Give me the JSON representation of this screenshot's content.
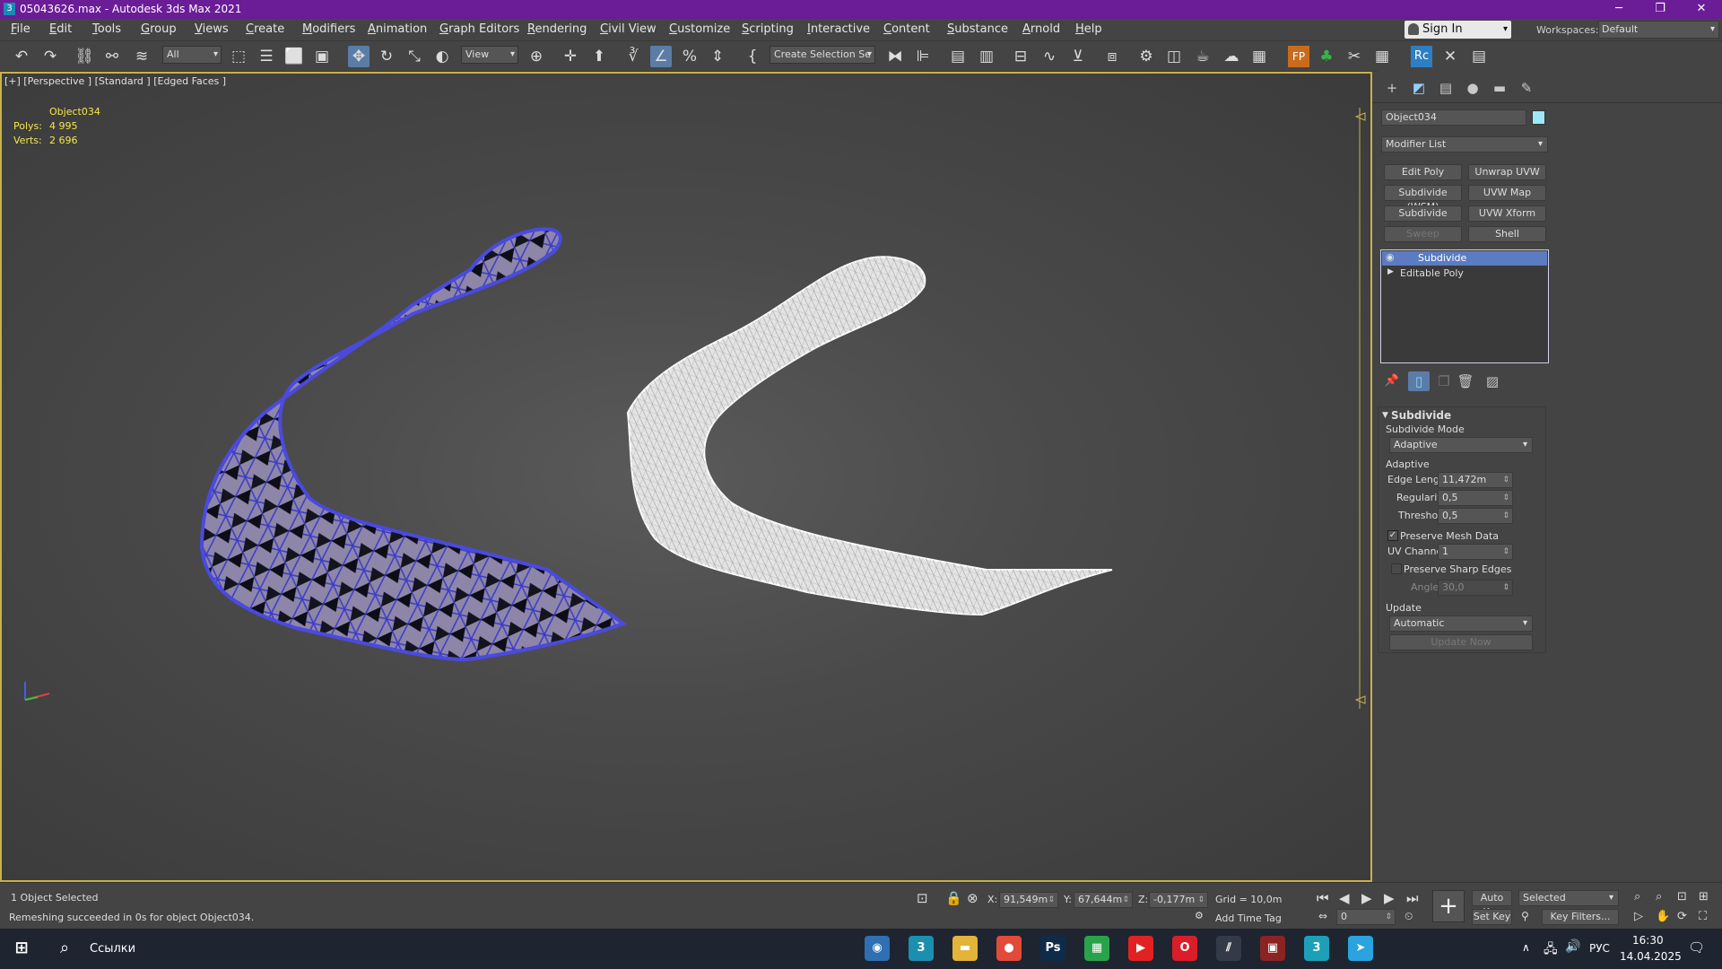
{
  "window": {
    "title": "05043626.max - Autodesk 3ds Max 2021",
    "app_icon": "3",
    "minimize_glyph": "─",
    "restore_glyph": "❐",
    "close_glyph": "✕"
  },
  "menu": {
    "items": [
      "File",
      "Edit",
      "Tools",
      "Group",
      "Views",
      "Create",
      "Modifiers",
      "Animation",
      "Graph Editors",
      "Rendering",
      "Civil View",
      "Customize",
      "Scripting",
      "Interactive",
      "Content",
      "Substance",
      "Arnold",
      "Help"
    ],
    "sign_in": "Sign In",
    "workspaces_label": "Workspaces:",
    "workspace_value": "Default"
  },
  "toolbar": {
    "filter_value": "All",
    "ref_coord_value": "View",
    "selection_set_placeholder": "Create Selection Se",
    "icons": [
      "undo-icon",
      "redo-icon",
      "link-icon",
      "unlink-icon",
      "bind-space-warp-icon",
      "select-object-icon",
      "select-by-name-icon",
      "rect-selection-icon",
      "window-crossing-icon",
      "select-move-icon",
      "select-rotate-icon",
      "select-scale-icon",
      "select-place-icon",
      "pivot-icon",
      "select-manipulate-icon",
      "keyboard-shortcut-icon",
      "snaps-toggle-icon",
      "angle-snap-icon",
      "percent-snap-icon",
      "spinner-snap-icon",
      "edit-named-selection-icon",
      "mirror-icon",
      "align-icon",
      "scene-explorer-icon",
      "layer-explorer-icon",
      "toggle-ribbon-icon",
      "curve-editor-icon",
      "schematic-view-icon",
      "material-editor-icon",
      "render-setup-icon",
      "rendered-frame-icon",
      "render-production-icon",
      "render-iterative-icon",
      "render-cloud-icon",
      "floorgenerator-icon",
      "forest-pack-icon",
      "railclone-icon",
      "tool-icon",
      "table-icon",
      "rc-icon",
      "wrench-icon",
      "spreadsheet-icon"
    ]
  },
  "viewport": {
    "label": "[+] [Perspective ] [Standard ] [Edged Faces ]",
    "object_name": "Object034",
    "polys_label": "Polys:",
    "polys_value": "4 995",
    "verts_label": "Verts:",
    "verts_value": "2 696"
  },
  "command_panel": {
    "tabs": [
      "create-tab-icon",
      "modify-tab-icon",
      "hierarchy-tab-icon",
      "motion-tab-icon",
      "display-tab-icon",
      "utilities-tab-icon"
    ],
    "object_name": "Object034",
    "object_color": "#9ee8f5",
    "modifier_list": "Modifier List",
    "modifier_buttons": [
      {
        "label": "Edit Poly",
        "enabled": true
      },
      {
        "label": "Unwrap UVW",
        "enabled": true
      },
      {
        "label": "Subdivide (WSM)",
        "enabled": true
      },
      {
        "label": "UVW Map",
        "enabled": true
      },
      {
        "label": "Subdivide",
        "enabled": true
      },
      {
        "label": "UVW Xform",
        "enabled": true
      },
      {
        "label": "Sweep",
        "enabled": false
      },
      {
        "label": "Shell",
        "enabled": true
      }
    ],
    "stack": [
      {
        "label": "Subdivide",
        "selected": true
      },
      {
        "label": "Editable Poly",
        "selected": false
      }
    ],
    "rollout": {
      "title": "Subdivide",
      "mode_label": "Subdivide Mode",
      "mode_value": "Adaptive",
      "adaptive_label": "Adaptive",
      "edge_length_label": "Edge Length:",
      "edge_length_value": "11,472m",
      "regularity_label": "Regularity:",
      "regularity_value": "0,5",
      "threshold_label": "Threshold:",
      "threshold_value": "0,5",
      "preserve_mesh_label": "Preserve Mesh Data",
      "preserve_mesh_checked": true,
      "uv_channel_label": "UV Channel:",
      "uv_channel_value": "1",
      "preserve_sharp_label": "Preserve Sharp Edges",
      "preserve_sharp_checked": false,
      "angle_label": "Angle:",
      "angle_value": "30,0",
      "update_label": "Update",
      "update_value": "Automatic",
      "update_now": "Update Now"
    }
  },
  "status": {
    "selected": "1 Object Selected",
    "message": "Remeshing succeeded in 0s for object Object034.",
    "x_label": "X:",
    "x_value": "91,549m",
    "y_label": "Y:",
    "y_value": "67,644m",
    "z_label": "Z:",
    "z_value": "-0,177m",
    "grid": "Grid = 10,0m",
    "add_time_tag": "Add Time Tag",
    "frame_value": "0",
    "auto_key": "Auto Key",
    "set_key": "Set Key",
    "key_mode": "Selected",
    "key_filters": "Key Filters..."
  },
  "taskbar": {
    "search_text": "Ссылки",
    "apps": [
      {
        "name": "app-cursor-icon",
        "label": "◉",
        "color": "#2f6fb3"
      },
      {
        "name": "app-3dsmax-icon",
        "label": "3",
        "color": "#1c8fb0"
      },
      {
        "name": "app-explorer-icon",
        "label": "▬",
        "color": "#e3b33a"
      },
      {
        "name": "app-chrome-icon",
        "label": "●",
        "color": "#e24a3a"
      },
      {
        "name": "app-photoshop-icon",
        "label": "Ps",
        "color": "#0f2b4a"
      },
      {
        "name": "app-chart-icon",
        "label": "▦",
        "color": "#29a34a"
      },
      {
        "name": "app-youtube-icon",
        "label": "▶",
        "color": "#e22222"
      },
      {
        "name": "app-opera-icon",
        "label": "O",
        "color": "#d91e2a"
      },
      {
        "name": "app-stripe-icon",
        "label": "⫽",
        "color": "#333a48"
      },
      {
        "name": "app-game-icon",
        "label": "▣",
        "color": "#8c2323"
      },
      {
        "name": "app-3dsmax-active-icon",
        "label": "3",
        "color": "#1ba0b8"
      },
      {
        "name": "app-telegram-icon",
        "label": "➤",
        "color": "#2aa3df"
      }
    ],
    "lang": "РУС",
    "time": "16:30",
    "date": "14.04.2025"
  }
}
